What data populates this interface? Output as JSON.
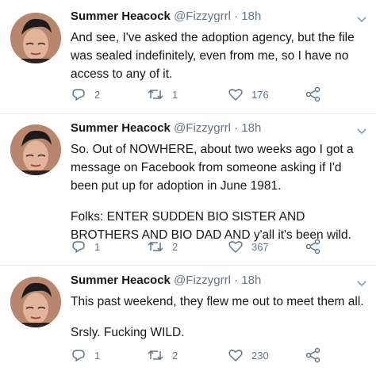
{
  "tweets": [
    {
      "name": "Summer Heacock",
      "handle": "@Fizzygrrl",
      "time": "· 18h",
      "paragraphs": [
        "And see, I've asked the adoption agency, but the file was sealed indefinitely, even from me, so I have no access to any of it."
      ],
      "replies": "2",
      "retweets": "1",
      "likes": "176"
    },
    {
      "name": "Summer Heacock",
      "handle": "@Fizzygrrl",
      "time": "· 18h",
      "paragraphs": [
        "So. Out of NOWHERE, about two weeks ago I got a message on Facebook from someone asking if I'd been put up for adoption in June 1981.",
        "Folks: ENTER SUDDEN BIO SISTER AND BROTHERS AND BIO DAD AND y'all it's been wild."
      ],
      "replies": "1",
      "retweets": "2",
      "likes": "367"
    },
    {
      "name": "Summer Heacock",
      "handle": "@Fizzygrrl",
      "time": "· 18h",
      "paragraphs": [
        "This past weekend, they flew me out to meet them all.",
        "Srsly. Fucking WILD."
      ],
      "replies": "1",
      "retweets": "2",
      "likes": "230"
    }
  ],
  "icons": {
    "reply": "reply-icon",
    "retweet": "retweet-icon",
    "like": "heart-icon",
    "share": "share-icon",
    "more": "chevron-down-icon",
    "avatar": "profile-photo"
  },
  "colors": {
    "text": "#14171a",
    "secondary": "#657786",
    "divider": "#e6ecf0"
  }
}
